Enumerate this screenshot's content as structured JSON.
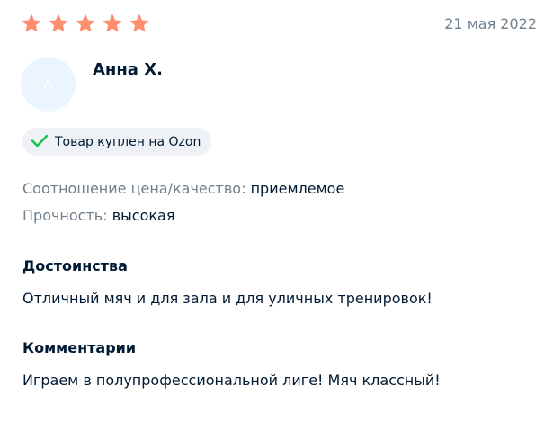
{
  "review": {
    "rating": 5,
    "rating_max": 5,
    "star_color": "#ff8e6e",
    "date": "21 мая 2022",
    "author": {
      "name": "Анна Х.",
      "avatar_letter": "A"
    },
    "badge": {
      "icon": "check-icon",
      "label": "Товар куплен на Ozon"
    },
    "attributes": [
      {
        "label": "Соотношение цена/качество:",
        "value": "приемлемое"
      },
      {
        "label": "Прочность:",
        "value": "высокая"
      }
    ],
    "pros": {
      "title": "Достоинства",
      "text": "Отличный мяч и для зала и для уличных тренировок!"
    },
    "comment": {
      "title": "Комментарии",
      "text": "Играем в полупрофессиональной лиге! Мяч классный!"
    }
  }
}
